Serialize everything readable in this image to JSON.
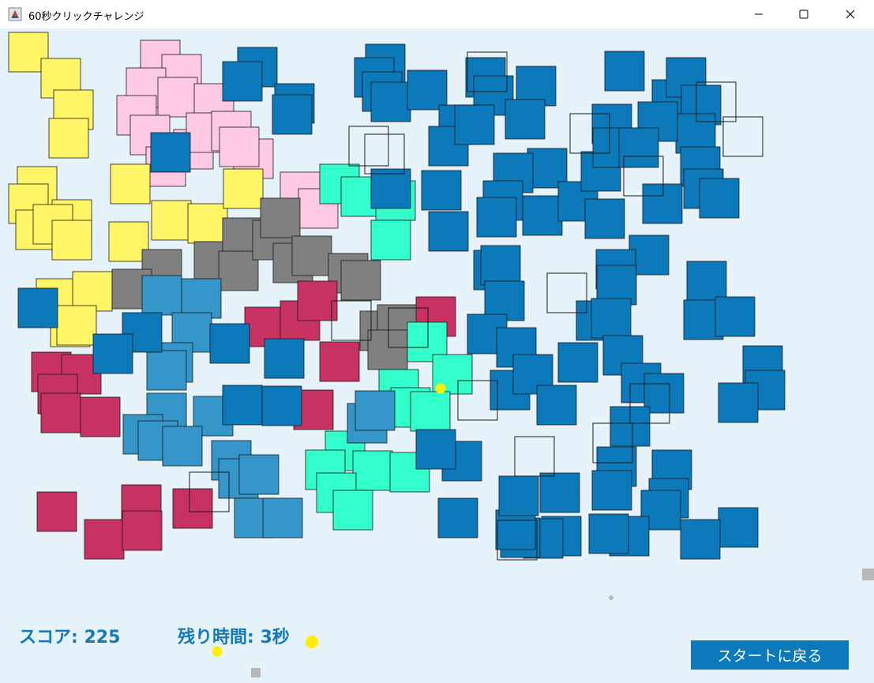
{
  "window": {
    "title": "60秒クリックチャレンジ",
    "controls": [
      "minimize-icon",
      "maximize-icon",
      "close-icon"
    ]
  },
  "game": {
    "score_label": "スコア: 225",
    "time_label": "残り時間: 3秒",
    "back_button": "スタートに戻る"
  },
  "colors": {
    "background": "#e6f2fa",
    "text_accent": "#1479b8",
    "button": "#0b79ba",
    "square_blue": "#0b79ba",
    "square_light_blue": "#3596c9",
    "square_pink": "#fdc9e3",
    "square_yellow": "#fff566",
    "square_gray": "#808080",
    "square_crimson": "#c83262",
    "square_mint": "#33ffcc",
    "dot_yellow": "#ffee00"
  }
}
